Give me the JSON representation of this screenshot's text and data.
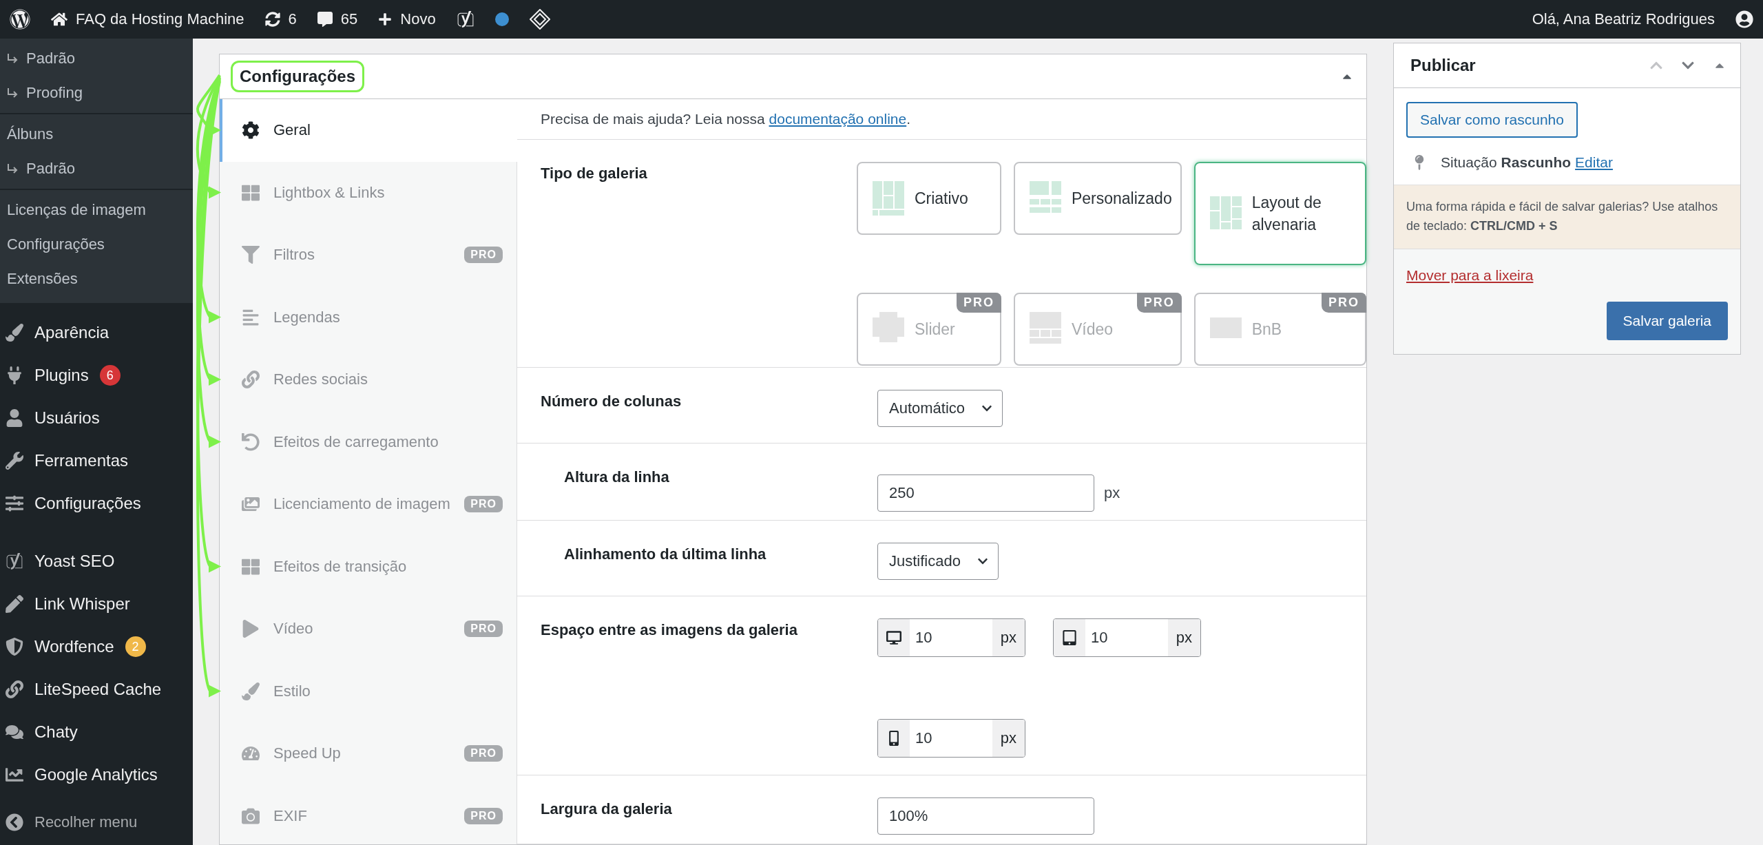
{
  "admin_bar": {
    "site_name": "FAQ da Hosting Machine",
    "updates": "6",
    "comments": "65",
    "new": "Novo",
    "greeting": "Olá, Ana Beatriz Rodrigues"
  },
  "sidebar": {
    "submenu_groups": [
      [
        {
          "label": "Padrão",
          "kind": "child"
        },
        {
          "label": "Proofing",
          "kind": "child"
        }
      ],
      [
        {
          "label": "Álbuns",
          "kind": "item"
        },
        {
          "label": "Padrão",
          "kind": "child"
        }
      ],
      [
        {
          "label": "Licenças de imagem",
          "kind": "item"
        },
        {
          "label": "Configurações",
          "kind": "item"
        },
        {
          "label": "Extensões",
          "kind": "item"
        }
      ]
    ],
    "menu_groups": [
      [
        {
          "label": "Aparência"
        },
        {
          "label": "Plugins",
          "badge": {
            "text": "6",
            "color": "#d63638"
          }
        },
        {
          "label": "Usuários"
        },
        {
          "label": "Ferramentas"
        },
        {
          "label": "Configurações"
        }
      ],
      [
        {
          "label": "Yoast SEO"
        },
        {
          "label": "Link Whisper"
        },
        {
          "label": "Wordfence",
          "badge": {
            "text": "2",
            "color": "#f0b849"
          }
        },
        {
          "label": "LiteSpeed Cache"
        },
        {
          "label": "Chaty"
        },
        {
          "label": "Google Analytics"
        }
      ]
    ],
    "collapse": "Recolher menu"
  },
  "settings": {
    "title": "Configurações",
    "highlighted": true,
    "tabs": [
      {
        "label": "Geral",
        "selected": true,
        "arrow": true
      },
      {
        "label": "Lightbox & Links",
        "selected": false,
        "arrow": true
      },
      {
        "label": "Filtros",
        "selected": false,
        "badge": "PRO",
        "arrow": false
      },
      {
        "label": "Legendas",
        "selected": false,
        "arrow": true
      },
      {
        "label": "Redes sociais",
        "selected": false,
        "arrow": true
      },
      {
        "label": "Efeitos de carregamento",
        "selected": false,
        "arrow": true
      },
      {
        "label": "Licenciamento de imagem",
        "selected": false,
        "badge": "PRO",
        "arrow": false
      },
      {
        "label": "Efeitos de transição",
        "selected": false,
        "arrow": true
      },
      {
        "label": "Vídeo",
        "selected": false,
        "badge": "PRO",
        "arrow": false
      },
      {
        "label": "Estilo",
        "selected": false,
        "arrow": true
      },
      {
        "label": "Speed Up",
        "selected": false,
        "badge": "PRO",
        "arrow": false
      },
      {
        "label": "EXIF",
        "selected": false,
        "badge": "PRO",
        "arrow": false
      }
    ],
    "help": "Precisa de mais ajuda? Leia nossa ",
    "help_link": "documentação online",
    "help_end": ".",
    "gallery_type": {
      "label": "Tipo de galeria",
      "options": [
        {
          "label": "Criativo",
          "selected": false,
          "disabled": false
        },
        {
          "label": "Personalizado",
          "selected": false,
          "disabled": false
        },
        {
          "label": "Layout de alvenaria",
          "selected": true,
          "disabled": false
        },
        {
          "label": "Slider",
          "selected": false,
          "disabled": true,
          "badge": "PRO"
        },
        {
          "label": "Vídeo",
          "selected": false,
          "disabled": true,
          "badge": "PRO"
        },
        {
          "label": "BnB",
          "selected": false,
          "disabled": true,
          "badge": "PRO"
        }
      ]
    },
    "columns": {
      "label": "Número de colunas",
      "value": "Automático"
    },
    "row_height": {
      "label": "Altura da linha",
      "value": "250",
      "unit": "px"
    },
    "last_row": {
      "label": "Alinhamento da última linha",
      "value": "Justificado"
    },
    "spacing": {
      "label": "Espaço entre as imagens da galeria",
      "fields": [
        {
          "value": "10",
          "unit": "px"
        },
        {
          "value": "10",
          "unit": "px"
        },
        {
          "value": "10",
          "unit": "px"
        }
      ]
    },
    "width": {
      "label": "Largura da galeria",
      "value": "100%"
    }
  },
  "publish": {
    "title": "Publicar",
    "save_draft": "Salvar como rascunho",
    "status_label": "Situação",
    "status_value": "Rascunho",
    "edit": "Editar",
    "note": "Uma forma rápida e fácil de salvar galerias? Use atalhos de teclado: **CTRL/CMD + S**",
    "trash": "Mover para a lixeira",
    "save": "Salvar galeria"
  }
}
